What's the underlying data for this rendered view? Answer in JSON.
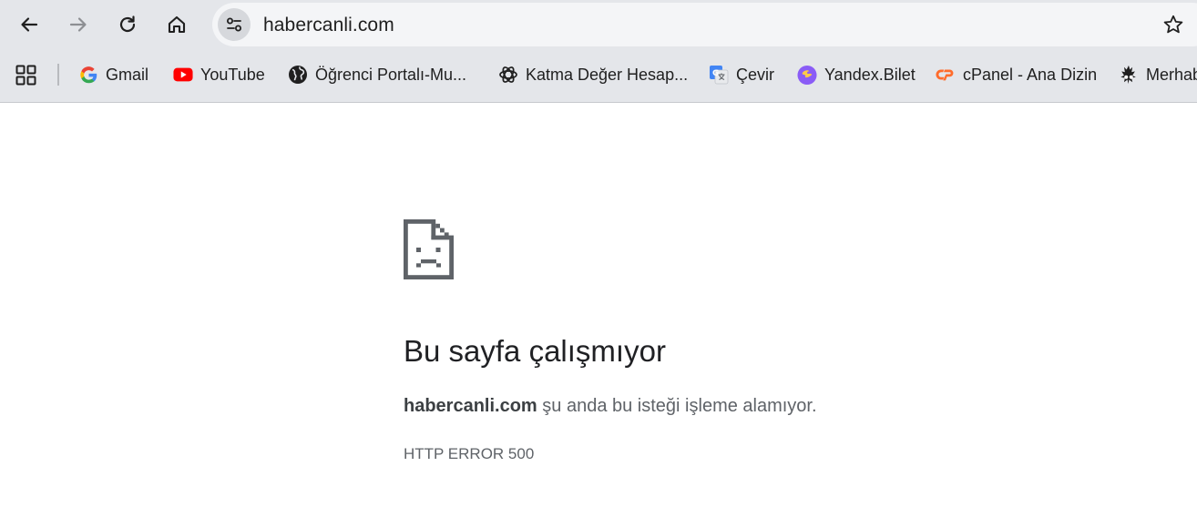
{
  "toolbar": {
    "back_icon": "arrow-left-icon",
    "forward_icon": "arrow-right-icon",
    "reload_icon": "reload-icon",
    "home_icon": "home-icon",
    "url": "habercanli.com",
    "site_info_icon": "tune-icon",
    "bookmark_star_icon": "star-icon"
  },
  "bookmarks": {
    "apps_icon": "grid-icon",
    "items": [
      {
        "label": "Gmail",
        "icon": "google-icon"
      },
      {
        "label": "YouTube",
        "icon": "youtube-icon"
      },
      {
        "label": "Öğrenci Portalı-Mu...",
        "icon": "globe-icon"
      },
      {
        "label": "Katma Değer Hesap...",
        "icon": "openai-icon"
      },
      {
        "label": "Çevir",
        "icon": "translate-icon"
      },
      {
        "label": "Yandex.Bilet",
        "icon": "yandex-bilet-icon"
      },
      {
        "label": "cPanel - Ana Dizin",
        "icon": "cpanel-icon"
      },
      {
        "label": "Merhab",
        "icon": "site-icon"
      }
    ]
  },
  "error": {
    "icon": "sad-page-icon",
    "title": "Bu sayfa çalışmıyor",
    "host": "habercanli.com",
    "message": " şu anda bu isteği işleme alamıyor.",
    "code": "HTTP ERROR 500"
  },
  "colors": {
    "toolbar_bg": "#e4e6ea",
    "omnibox_bg": "#f4f5f7",
    "youtube_red": "#ff0000",
    "cpanel_orange": "#ff6c2c",
    "yandex_purple": "#8a5cf6"
  }
}
